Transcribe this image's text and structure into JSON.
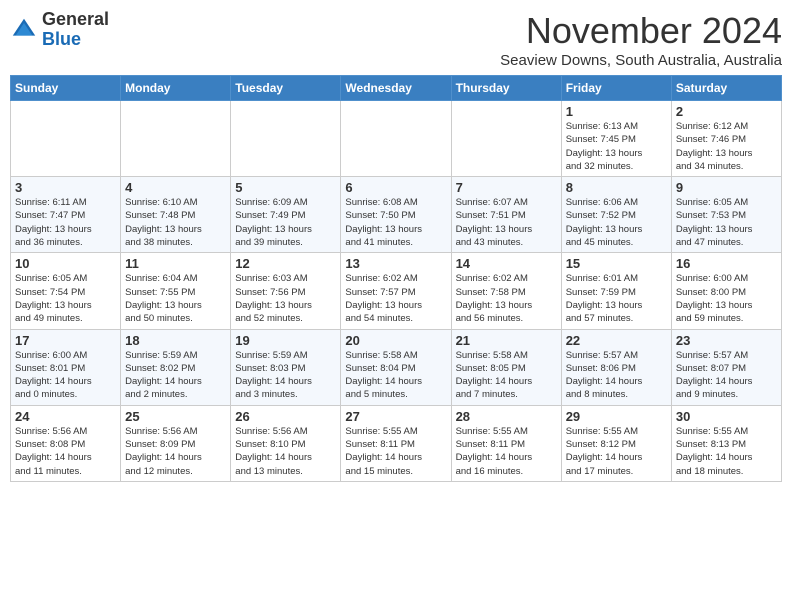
{
  "header": {
    "logo_line1": "General",
    "logo_line2": "Blue",
    "month_title": "November 2024",
    "subtitle": "Seaview Downs, South Australia, Australia"
  },
  "weekdays": [
    "Sunday",
    "Monday",
    "Tuesday",
    "Wednesday",
    "Thursday",
    "Friday",
    "Saturday"
  ],
  "weeks": [
    [
      {
        "day": "",
        "info": ""
      },
      {
        "day": "",
        "info": ""
      },
      {
        "day": "",
        "info": ""
      },
      {
        "day": "",
        "info": ""
      },
      {
        "day": "",
        "info": ""
      },
      {
        "day": "1",
        "info": "Sunrise: 6:13 AM\nSunset: 7:45 PM\nDaylight: 13 hours\nand 32 minutes."
      },
      {
        "day": "2",
        "info": "Sunrise: 6:12 AM\nSunset: 7:46 PM\nDaylight: 13 hours\nand 34 minutes."
      }
    ],
    [
      {
        "day": "3",
        "info": "Sunrise: 6:11 AM\nSunset: 7:47 PM\nDaylight: 13 hours\nand 36 minutes."
      },
      {
        "day": "4",
        "info": "Sunrise: 6:10 AM\nSunset: 7:48 PM\nDaylight: 13 hours\nand 38 minutes."
      },
      {
        "day": "5",
        "info": "Sunrise: 6:09 AM\nSunset: 7:49 PM\nDaylight: 13 hours\nand 39 minutes."
      },
      {
        "day": "6",
        "info": "Sunrise: 6:08 AM\nSunset: 7:50 PM\nDaylight: 13 hours\nand 41 minutes."
      },
      {
        "day": "7",
        "info": "Sunrise: 6:07 AM\nSunset: 7:51 PM\nDaylight: 13 hours\nand 43 minutes."
      },
      {
        "day": "8",
        "info": "Sunrise: 6:06 AM\nSunset: 7:52 PM\nDaylight: 13 hours\nand 45 minutes."
      },
      {
        "day": "9",
        "info": "Sunrise: 6:05 AM\nSunset: 7:53 PM\nDaylight: 13 hours\nand 47 minutes."
      }
    ],
    [
      {
        "day": "10",
        "info": "Sunrise: 6:05 AM\nSunset: 7:54 PM\nDaylight: 13 hours\nand 49 minutes."
      },
      {
        "day": "11",
        "info": "Sunrise: 6:04 AM\nSunset: 7:55 PM\nDaylight: 13 hours\nand 50 minutes."
      },
      {
        "day": "12",
        "info": "Sunrise: 6:03 AM\nSunset: 7:56 PM\nDaylight: 13 hours\nand 52 minutes."
      },
      {
        "day": "13",
        "info": "Sunrise: 6:02 AM\nSunset: 7:57 PM\nDaylight: 13 hours\nand 54 minutes."
      },
      {
        "day": "14",
        "info": "Sunrise: 6:02 AM\nSunset: 7:58 PM\nDaylight: 13 hours\nand 56 minutes."
      },
      {
        "day": "15",
        "info": "Sunrise: 6:01 AM\nSunset: 7:59 PM\nDaylight: 13 hours\nand 57 minutes."
      },
      {
        "day": "16",
        "info": "Sunrise: 6:00 AM\nSunset: 8:00 PM\nDaylight: 13 hours\nand 59 minutes."
      }
    ],
    [
      {
        "day": "17",
        "info": "Sunrise: 6:00 AM\nSunset: 8:01 PM\nDaylight: 14 hours\nand 0 minutes."
      },
      {
        "day": "18",
        "info": "Sunrise: 5:59 AM\nSunset: 8:02 PM\nDaylight: 14 hours\nand 2 minutes."
      },
      {
        "day": "19",
        "info": "Sunrise: 5:59 AM\nSunset: 8:03 PM\nDaylight: 14 hours\nand 3 minutes."
      },
      {
        "day": "20",
        "info": "Sunrise: 5:58 AM\nSunset: 8:04 PM\nDaylight: 14 hours\nand 5 minutes."
      },
      {
        "day": "21",
        "info": "Sunrise: 5:58 AM\nSunset: 8:05 PM\nDaylight: 14 hours\nand 7 minutes."
      },
      {
        "day": "22",
        "info": "Sunrise: 5:57 AM\nSunset: 8:06 PM\nDaylight: 14 hours\nand 8 minutes."
      },
      {
        "day": "23",
        "info": "Sunrise: 5:57 AM\nSunset: 8:07 PM\nDaylight: 14 hours\nand 9 minutes."
      }
    ],
    [
      {
        "day": "24",
        "info": "Sunrise: 5:56 AM\nSunset: 8:08 PM\nDaylight: 14 hours\nand 11 minutes."
      },
      {
        "day": "25",
        "info": "Sunrise: 5:56 AM\nSunset: 8:09 PM\nDaylight: 14 hours\nand 12 minutes."
      },
      {
        "day": "26",
        "info": "Sunrise: 5:56 AM\nSunset: 8:10 PM\nDaylight: 14 hours\nand 13 minutes."
      },
      {
        "day": "27",
        "info": "Sunrise: 5:55 AM\nSunset: 8:11 PM\nDaylight: 14 hours\nand 15 minutes."
      },
      {
        "day": "28",
        "info": "Sunrise: 5:55 AM\nSunset: 8:11 PM\nDaylight: 14 hours\nand 16 minutes."
      },
      {
        "day": "29",
        "info": "Sunrise: 5:55 AM\nSunset: 8:12 PM\nDaylight: 14 hours\nand 17 minutes."
      },
      {
        "day": "30",
        "info": "Sunrise: 5:55 AM\nSunset: 8:13 PM\nDaylight: 14 hours\nand 18 minutes."
      }
    ]
  ]
}
